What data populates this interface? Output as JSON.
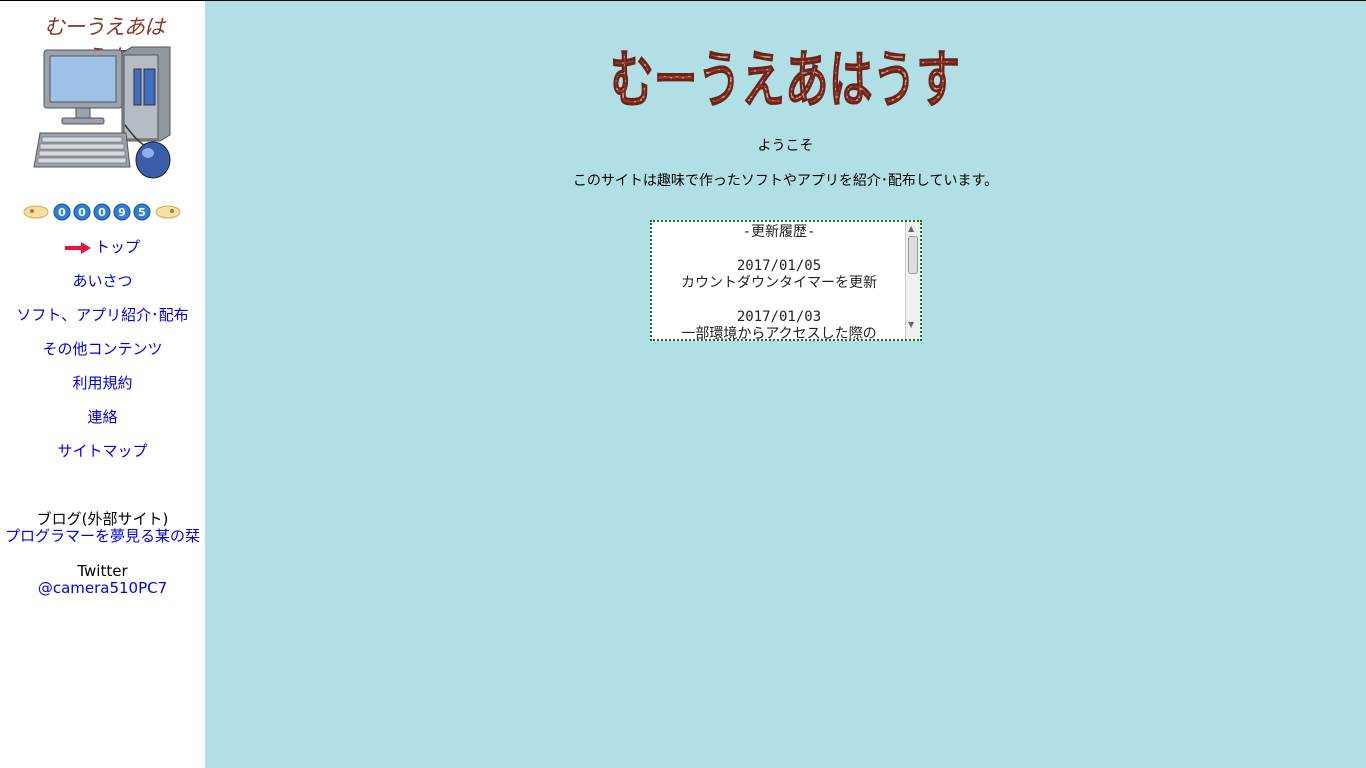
{
  "sidebar": {
    "logo_text": "むーうえあはうす",
    "counter_digits": [
      "0",
      "0",
      "0",
      "9",
      "5"
    ],
    "nav": [
      {
        "label": "トップ",
        "current": true
      },
      {
        "label": "あいさつ"
      },
      {
        "label": "ソフト、アプリ紹介･配布"
      },
      {
        "label": "その他コンテンツ"
      },
      {
        "label": "利用規約"
      },
      {
        "label": "連絡"
      },
      {
        "label": "サイトマップ"
      }
    ],
    "blog_label": "ブログ(外部サイト)",
    "blog_link": "プログラマーを夢見る某の栞",
    "twitter_label": "Twitter",
    "twitter_link": "@camera510PC7"
  },
  "main": {
    "title": "むーうえあはうす",
    "welcome": "ようこそ",
    "intro": "このサイトは趣味で作ったソフトやアプリを紹介･配布しています。",
    "history": {
      "header": "-更新履歴-",
      "entries": [
        {
          "date": "2017/01/05",
          "text": "カウントダウンタイマーを更新"
        },
        {
          "date": "2017/01/03",
          "text": "一部環境からアクセスした際の"
        }
      ]
    }
  },
  "colors": {
    "background": "#b0dfe5",
    "sidebar": "#ffffff",
    "link": "#0000ee",
    "title_brick": "#8b3a2a",
    "history_border": "#0a7a0a"
  }
}
